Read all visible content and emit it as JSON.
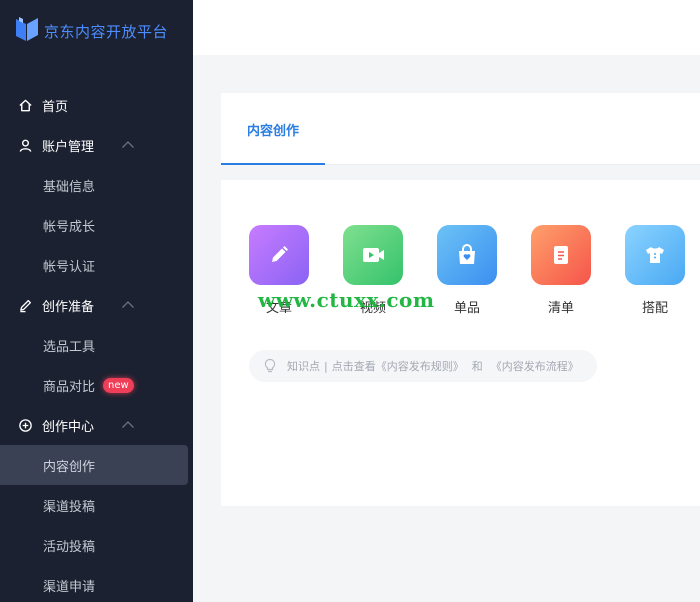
{
  "brand": {
    "name": "京东内容开放平台",
    "color": "#4c8dff"
  },
  "sidebar": {
    "items": [
      {
        "type": "top",
        "label": "首页",
        "icon": "home-icon"
      },
      {
        "type": "top",
        "label": "账户管理",
        "icon": "user-icon",
        "expanded": true
      },
      {
        "type": "sub",
        "label": "基础信息"
      },
      {
        "type": "sub",
        "label": "帐号成长"
      },
      {
        "type": "sub",
        "label": "帐号认证"
      },
      {
        "type": "top",
        "label": "创作准备",
        "icon": "pencil-icon",
        "expanded": true
      },
      {
        "type": "sub",
        "label": "选品工具"
      },
      {
        "type": "sub",
        "label": "商品对比",
        "badge": "new"
      },
      {
        "type": "top",
        "label": "创作中心",
        "icon": "plus-circle-icon",
        "expanded": true
      },
      {
        "type": "sub",
        "label": "内容创作",
        "active": true
      },
      {
        "type": "sub",
        "label": "渠道投稿"
      },
      {
        "type": "sub",
        "label": "活动投稿"
      },
      {
        "type": "sub",
        "label": "渠道申请"
      }
    ]
  },
  "tabs": [
    {
      "label": "内容创作",
      "active": true
    }
  ],
  "content_types": [
    {
      "label": "文章",
      "icon": "pencil-icon",
      "color_from": "#c77cff",
      "color_to": "#8a63f4"
    },
    {
      "label": "视频",
      "icon": "video-icon",
      "color_from": "#7fe08f",
      "color_to": "#35c26b"
    },
    {
      "label": "单品",
      "icon": "bag-icon",
      "color_from": "#6cc3f5",
      "color_to": "#3b8ff0"
    },
    {
      "label": "清单",
      "icon": "list-icon",
      "color_from": "#ffa06b",
      "color_to": "#f5554a"
    },
    {
      "label": "搭配",
      "icon": "shirt-icon",
      "color_from": "#8ad3ff",
      "color_to": "#4aa9f3"
    }
  ],
  "tip": {
    "prefix": "知识点",
    "separator": "|",
    "text": "点击查看",
    "link1": "《内容发布规则》",
    "and": "和",
    "link2": "《内容发布流程》"
  },
  "watermark": "www.ctuxx.com",
  "colors": {
    "sidebar_bg": "#1b2130",
    "active_bg": "#3a4155",
    "accent": "#2a7de1",
    "badge": "#ef3e58"
  }
}
